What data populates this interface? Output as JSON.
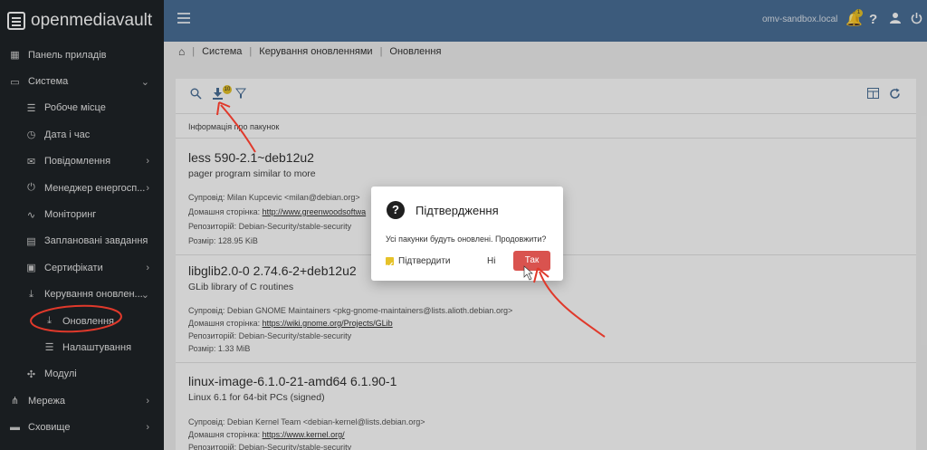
{
  "app": {
    "brand": "openmediavault",
    "host": "omv-sandbox.local",
    "notification_count": "1"
  },
  "sidebar": {
    "items": [
      {
        "label": "Панель приладів",
        "icon": "dashboard-icon"
      },
      {
        "label": "Система",
        "icon": "laptop-icon"
      },
      {
        "label": "Робоче місце",
        "icon": "sliders-icon"
      },
      {
        "label": "Дата і час",
        "icon": "clock-icon"
      },
      {
        "label": "Повідомлення",
        "icon": "mail-icon"
      },
      {
        "label": "Менеджер енергосп...",
        "icon": "power-plug-icon"
      },
      {
        "label": "Моніторинг",
        "icon": "heartbeat-icon"
      },
      {
        "label": "Заплановані завдання",
        "icon": "calendar-icon"
      },
      {
        "label": "Сертифікати",
        "icon": "certificate-icon"
      },
      {
        "label": "Керування оновлен...",
        "icon": "download-icon"
      },
      {
        "label": "Оновлення",
        "icon": "download-icon"
      },
      {
        "label": "Налаштування",
        "icon": "sliders-icon"
      },
      {
        "label": "Модулі",
        "icon": "puzzle-icon"
      },
      {
        "label": "Мережа",
        "icon": "network-icon"
      },
      {
        "label": "Сховище",
        "icon": "storage-icon"
      }
    ]
  },
  "breadcrumb": [
    "Система",
    "Керування оновленнями",
    "Оновлення"
  ],
  "toolbar": {
    "download_badge": "10"
  },
  "table": {
    "column_header": "Інформація про пакунок",
    "packages": [
      {
        "title": "less 590-2.1~deb12u2",
        "desc": "pager program similar to more",
        "maintainer": "Супровід: Milan Kupcevic <milan@debian.org>",
        "homepage_label": "Домашня сторінка: ",
        "homepage_link": "http://www.greenwoodsoftwa",
        "repo": "Репозиторій: Debian-Security/stable-security",
        "size": "Розмір: 128.95 KiB"
      },
      {
        "title": "libglib2.0-0 2.74.6-2+deb12u2",
        "desc": "GLib library of C routines",
        "maintainer": "Супровід: Debian GNOME Maintainers <pkg-gnome-maintainers@lists.alioth.debian.org>",
        "homepage_label": "Домашня сторінка: ",
        "homepage_link": "https://wiki.gnome.org/Projects/GLib",
        "repo": "Репозиторій: Debian-Security/stable-security",
        "size": "Розмір: 1.33 MiB"
      },
      {
        "title": "linux-image-6.1.0-21-amd64 6.1.90-1",
        "desc": "Linux 6.1 for 64-bit PCs (signed)",
        "maintainer": "Супровід: Debian Kernel Team <debian-kernel@lists.debian.org>",
        "homepage_label": "Домашня сторінка: ",
        "homepage_link": "https://www.kernel.org/",
        "repo": "Репозиторій: Debian-Security/stable-security"
      }
    ]
  },
  "dialog": {
    "title": "Підтвердження",
    "message": "Усі пакунки будуть оновлені. Продовжити?",
    "confirm_label": "Підтвердити",
    "no_label": "Ні",
    "yes_label": "Так"
  },
  "colors": {
    "accent": "#4a6f98",
    "sidebar": "#1f2428",
    "danger": "#d9534f",
    "badge": "#e6c229",
    "annotation": "#e0392b"
  }
}
